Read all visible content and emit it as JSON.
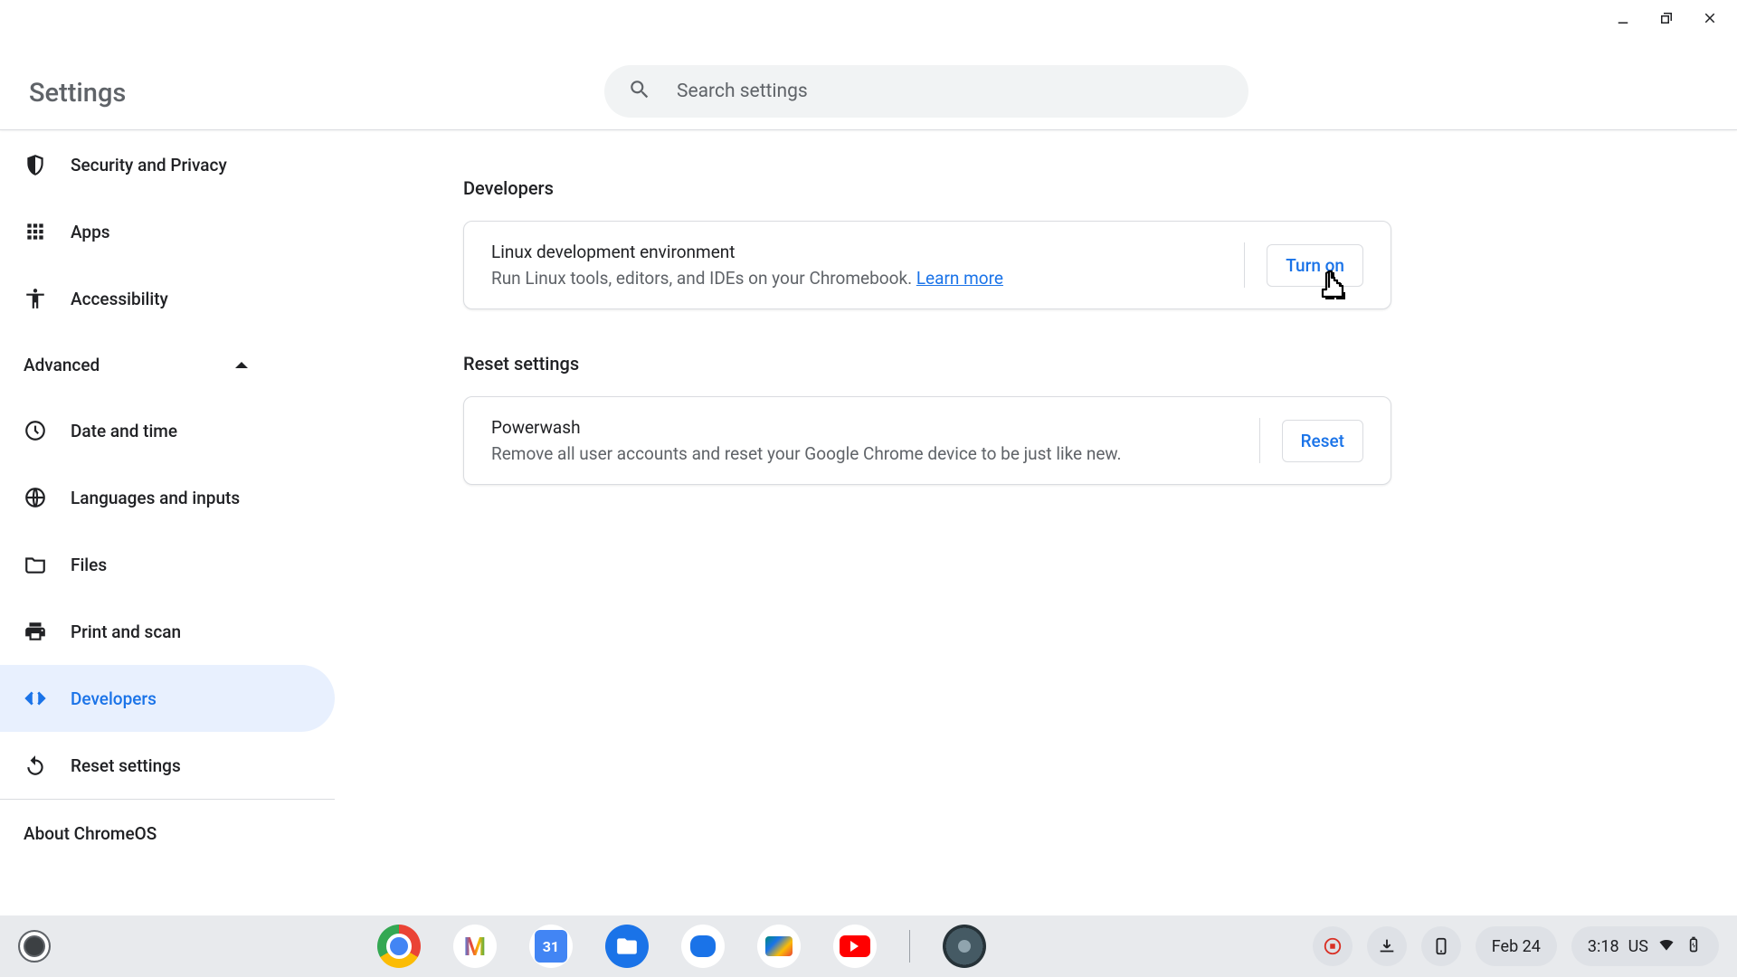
{
  "window": {
    "title": "Settings"
  },
  "search": {
    "placeholder": "Search settings"
  },
  "sidebar": {
    "top_items": [
      {
        "id": "security-privacy",
        "label": "Security and Privacy"
      },
      {
        "id": "apps",
        "label": "Apps"
      },
      {
        "id": "accessibility",
        "label": "Accessibility"
      }
    ],
    "advanced_label": "Advanced",
    "advanced_items": [
      {
        "id": "date-time",
        "label": "Date and time"
      },
      {
        "id": "languages",
        "label": "Languages and inputs"
      },
      {
        "id": "files",
        "label": "Files"
      },
      {
        "id": "print-scan",
        "label": "Print and scan"
      },
      {
        "id": "developers",
        "label": "Developers"
      },
      {
        "id": "reset-settings",
        "label": "Reset settings"
      }
    ],
    "about_label": "About ChromeOS"
  },
  "main": {
    "developers": {
      "heading": "Developers",
      "card_title": "Linux development environment",
      "card_subtitle_text": "Run Linux tools, editors, and IDEs on your Chromebook. ",
      "card_link": "Learn more",
      "button": "Turn on"
    },
    "reset": {
      "heading": "Reset settings",
      "card_title": "Powerwash",
      "card_subtitle": "Remove all user accounts and reset your Google Chrome device to be just like new.",
      "button": "Reset"
    }
  },
  "shelf": {
    "apps": [
      {
        "id": "chrome",
        "name": "Chrome"
      },
      {
        "id": "gmail",
        "name": "Gmail"
      },
      {
        "id": "calendar",
        "name": "Calendar"
      },
      {
        "id": "files",
        "name": "Files"
      },
      {
        "id": "messages",
        "name": "Messages"
      },
      {
        "id": "meet",
        "name": "Meet"
      },
      {
        "id": "youtube",
        "name": "YouTube"
      },
      {
        "id": "settings",
        "name": "Settings"
      }
    ],
    "date": "Feb 24",
    "time": "3:18",
    "locale": "US"
  }
}
